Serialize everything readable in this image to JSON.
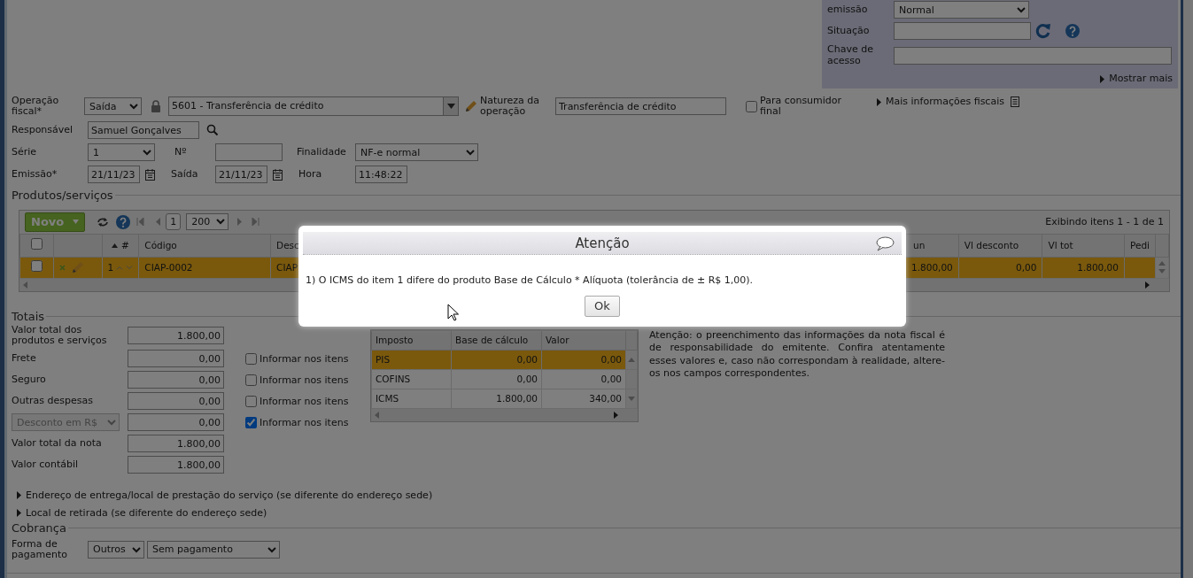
{
  "emission_panel": {
    "type_label": "emissão",
    "type_value": "Normal",
    "status_label": "Situação",
    "key_label": "Chave de acesso",
    "more_link": "Mostrar mais"
  },
  "operation": {
    "label": "Operação fiscal*",
    "direction": "Saída",
    "cfop": "5601 - Transferência de crédito",
    "nature_label": "Natureza da operação",
    "nature_value": "Transferência de crédito",
    "final_consumer": {
      "label": "Para consumidor final",
      "checked": false
    },
    "fiscal_info_link": "Mais informações fiscais"
  },
  "responsible": {
    "label": "Responsável",
    "value": "Samuel Gonçalves"
  },
  "series": {
    "label": "Série",
    "value": "1",
    "number_label": "Nº",
    "purpose_label": "Finalidade",
    "purpose_value": "NF-e normal"
  },
  "dates": {
    "issue_label": "Emissão*",
    "issue_value": "21/11/23",
    "exit_label": "Saída",
    "exit_value": "21/11/23",
    "time_label": "Hora",
    "time_value": "11:48:22"
  },
  "products": {
    "title": "Produtos/serviços",
    "new_button": "Novo",
    "page": "1",
    "page_size": "200",
    "summary": "Exibindo itens 1 - 1 de 1",
    "all_checked": false,
    "columns": [
      "#",
      "Código",
      "Desc",
      "un",
      "Vl desconto",
      "Vl tot",
      "Pedi"
    ],
    "rows": [
      {
        "selected": true,
        "checked": false,
        "cells": [
          "1",
          "CIAP-0002",
          "CIAP",
          "1.800,00",
          "0,00",
          "1.800,00"
        ]
      }
    ]
  },
  "totals": {
    "title": "Totais",
    "rows": [
      {
        "kind": "field",
        "label": "Valor total dos produtos e serviços",
        "value": "1.800,00"
      },
      {
        "kind": "field",
        "label": "Frete",
        "value": "0,00",
        "item_option": {
          "label": "Informar nos itens",
          "checked": false
        }
      },
      {
        "kind": "field",
        "label": "Seguro",
        "value": "0,00",
        "item_option": {
          "label": "Informar nos itens",
          "checked": false
        }
      },
      {
        "kind": "field",
        "label": "Outras despesas",
        "value": "0,00",
        "item_option": {
          "label": "Informar nos itens",
          "checked": false
        }
      },
      {
        "kind": "select",
        "label": "Desconto em R$",
        "value": "0,00",
        "item_option": {
          "label": "Informar nos itens",
          "checked": true
        }
      },
      {
        "kind": "field",
        "label": "Valor total da nota",
        "value": "1.800,00"
      },
      {
        "kind": "field",
        "label": "Valor contábil",
        "value": "1.800,00"
      }
    ]
  },
  "tax_table": {
    "columns": [
      "Imposto",
      "Base de cálculo",
      "Valor"
    ],
    "rows": [
      {
        "selected": true,
        "cells": [
          "PIS",
          "0,00",
          "0,00"
        ]
      },
      {
        "selected": false,
        "cells": [
          "COFINS",
          "0,00",
          "0,00"
        ]
      },
      {
        "selected": false,
        "cells": [
          "ICMS",
          "1.800,00",
          "340,00"
        ]
      }
    ]
  },
  "note": "Atenção: o preenchimento das informações da nota fiscal é de responsabilidade do emitente. Confira atentamente esses valores e, caso não correspondam à realidade, altere-os nos campos correspondentes.",
  "sections": [
    {
      "label": "Endereço de entrega/local de prestação do serviço (se diferente do endereço sede)",
      "expanded": false
    },
    {
      "label": "Local de retirada (se diferente do endereço sede)",
      "expanded": false
    }
  ],
  "billing": {
    "title": "Cobrança",
    "label": "Forma de pagamento",
    "method": "Outros",
    "condition": "Sem pagamento"
  },
  "dialog": {
    "title": "Atenção",
    "message": "1) O ICMS do item 1 difere do produto Base de Cálculo * Alíquota (tolerância de ± R$ 1,00).",
    "button": "Ok"
  }
}
